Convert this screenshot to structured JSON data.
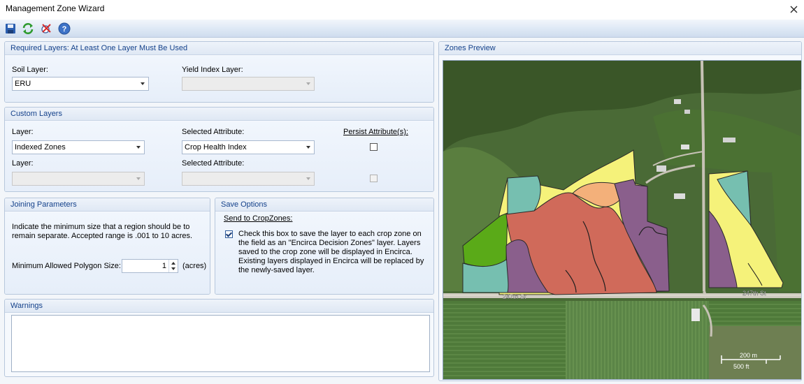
{
  "window": {
    "title": "Management Zone Wizard"
  },
  "toolbar": {
    "save_icon": "save-icon",
    "refresh_icon": "refresh-icon",
    "stop_icon": "stop-icon",
    "help_icon": "help-icon"
  },
  "required_layers": {
    "header": "Required Layers: At Least One Layer Must Be Used",
    "soil_label": "Soil Layer:",
    "soil_value": "ERU",
    "yield_label": "Yield Index Layer:",
    "yield_value": ""
  },
  "custom_layers": {
    "header": "Custom Layers",
    "layer_label": "Layer:",
    "attribute_label": "Selected Attribute:",
    "persist_label": "Persist Attribute(s):",
    "rows": [
      {
        "layer": "Indexed Zones",
        "attribute": "Crop Health Index",
        "persist": false
      },
      {
        "layer": "",
        "attribute": "",
        "persist": false
      }
    ]
  },
  "joining": {
    "header": "Joining Parameters",
    "description": "Indicate the minimum size that a region should be to remain separate. Accepted range is .001 to 10 acres.",
    "min_label": "Minimum Allowed Polygon Size:",
    "min_value": "1",
    "unit": "(acres)"
  },
  "save_options": {
    "header": "Save Options",
    "send_label": "Send to CropZones:",
    "checked": true,
    "description": "Check this box to save the layer to each crop zone on the field as an \"Encirca Decision Zones\" layer.  Layers saved to the crop zone will be displayed in Encirca. Existing layers displayed in Encirca will be replaced by the newly-saved layer."
  },
  "warnings": {
    "header": "Warnings",
    "text": ""
  },
  "preview": {
    "header": "Zones Preview",
    "road_label_1": "247th St",
    "road_label_2": "247th St",
    "scale_metric": "200 m",
    "scale_imperial": "500 ft"
  },
  "colors": {
    "header_text": "#15428b",
    "zone_red": "#d06a5a",
    "zone_purple": "#8a5f8c",
    "zone_yellow": "#f5f27a",
    "zone_teal": "#76bfb0",
    "zone_orange": "#f3b07a",
    "zone_green": "#5aaa18"
  }
}
